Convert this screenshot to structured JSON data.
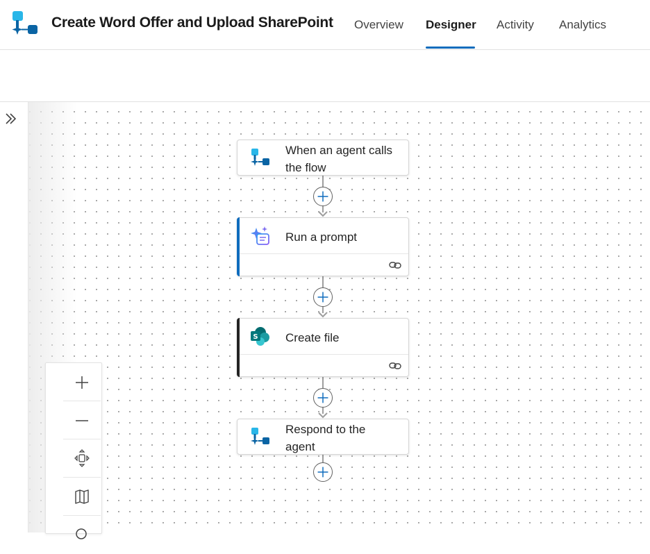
{
  "app": {
    "title": "Create Word Offer and Upload SharePoint"
  },
  "tabs": [
    {
      "label": "Overview",
      "active": false
    },
    {
      "label": "Designer",
      "active": true
    },
    {
      "label": "Activity",
      "active": false
    },
    {
      "label": "Analytics",
      "active": false
    }
  ],
  "flow": {
    "nodes": [
      {
        "title_line1": "When an agent calls",
        "title_line2": "the flow",
        "icon": "agent-flow-icon"
      },
      {
        "title": "Run a prompt",
        "icon": "ai-prompt-icon",
        "accent": "#0f6cbd"
      },
      {
        "title": "Create file",
        "icon": "sharepoint-icon",
        "accent": "#242424"
      },
      {
        "title_line1": "Respond to the",
        "title_line2": "agent",
        "icon": "agent-flow-icon"
      }
    ]
  },
  "zoom_controls": [
    "zoom-in-icon",
    "zoom-out-icon",
    "fit-view-icon",
    "minimap-icon",
    "search-icon"
  ],
  "colors": {
    "accent": "#0f6cbd",
    "flow_icon_light": "#29b6e8",
    "flow_icon_dark": "#0a64a4",
    "sharepoint": "#038387"
  }
}
